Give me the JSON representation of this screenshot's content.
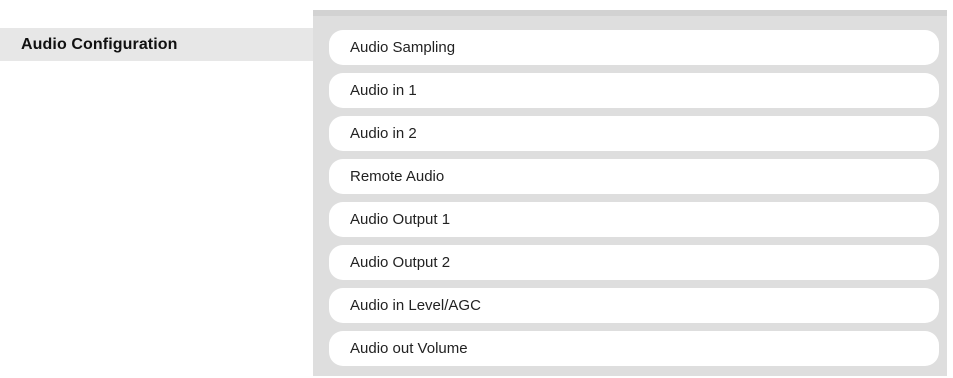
{
  "section": {
    "title": "Audio Configuration"
  },
  "menu": {
    "items": [
      {
        "label": "Audio Sampling"
      },
      {
        "label": "Audio in 1"
      },
      {
        "label": "Audio in 2"
      },
      {
        "label": "Remote Audio"
      },
      {
        "label": "Audio Output 1"
      },
      {
        "label": "Audio Output 2"
      },
      {
        "label": "Audio in Level/AGC"
      },
      {
        "label": "Audio out Volume"
      }
    ]
  }
}
